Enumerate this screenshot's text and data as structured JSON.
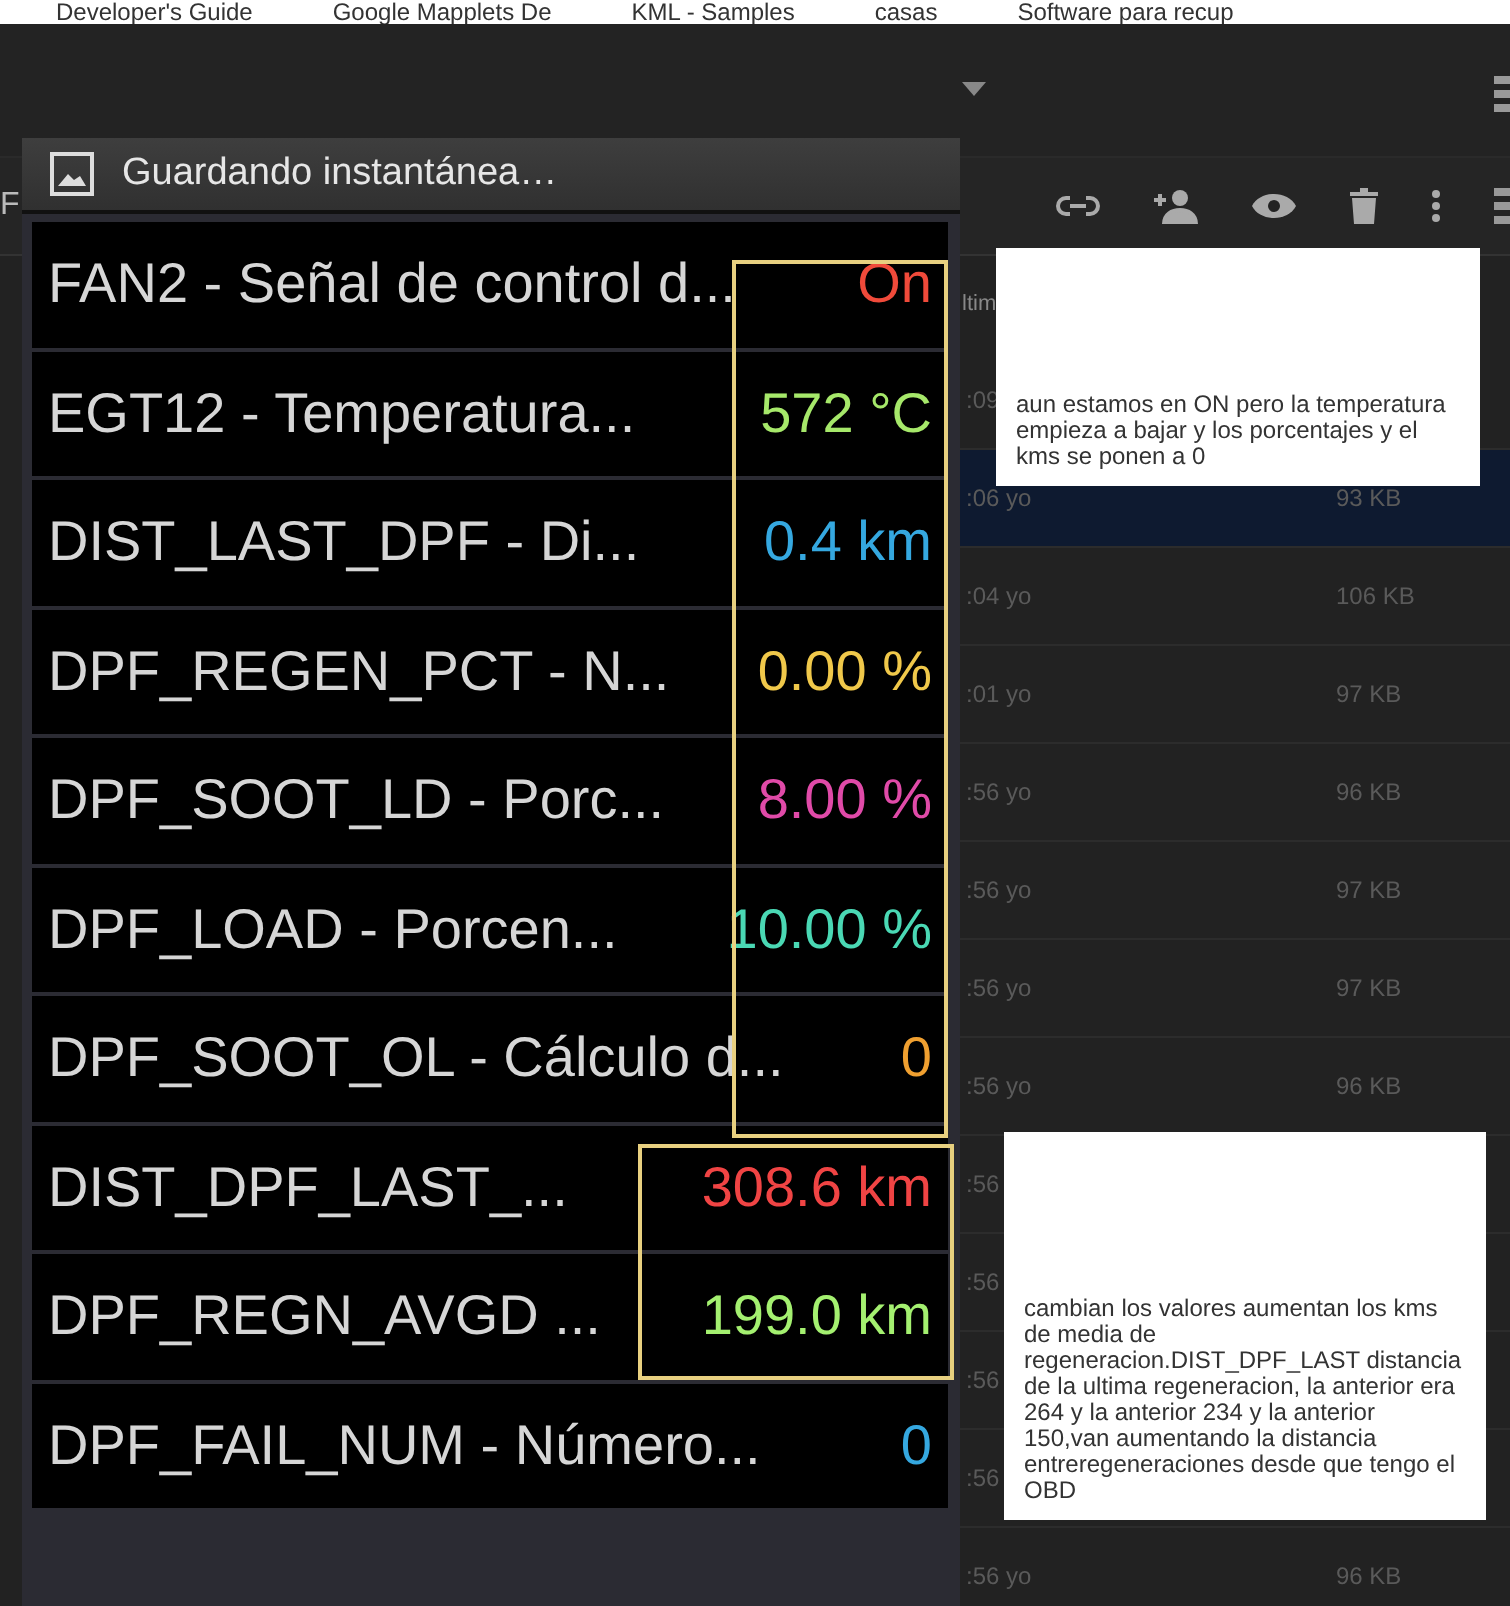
{
  "bookmarks": [
    "Developer's Guide",
    "Google Mapplets De",
    "KML - Samples",
    "casas",
    "Software para recup"
  ],
  "drive": {
    "column_heading": "ltim",
    "left_letter": "F",
    "rows": [
      {
        "time": ":09",
        "selected": false
      },
      {
        "time": ":06 yo",
        "size": "93 KB",
        "selected": true
      },
      {
        "time": ":04 yo",
        "size": "106 KB",
        "selected": false
      },
      {
        "time": ":01 yo",
        "size": "97 KB",
        "selected": false
      },
      {
        "time": ":56 yo",
        "size": "96 KB",
        "selected": false
      },
      {
        "time": ":56 yo",
        "size": "97 KB",
        "selected": false
      },
      {
        "time": ":56 yo",
        "size": "97 KB",
        "selected": false
      },
      {
        "time": ":56 yo",
        "size": "96 KB",
        "selected": false
      },
      {
        "time": ":56",
        "selected": false
      },
      {
        "time": ":56",
        "selected": false
      },
      {
        "time": ":56",
        "selected": false
      },
      {
        "time": ":56",
        "selected": false
      },
      {
        "time": ":56 yo",
        "size": "96 KB",
        "selected": false
      }
    ]
  },
  "snapshot": {
    "title": "Guardando instantánea…",
    "sensors": [
      {
        "name": "FAN2 - Señal de control d...",
        "value": "On",
        "color": "#f04a3a"
      },
      {
        "name": "EGT12 - Temperatura...",
        "value": "572 °C",
        "color": "#a6e86a"
      },
      {
        "name": "DIST_LAST_DPF - Di...",
        "value": "0.4 km",
        "color": "#35a8e0"
      },
      {
        "name": "DPF_REGEN_PCT - N...",
        "value": "0.00 %",
        "color": "#f0c84a"
      },
      {
        "name": "DPF_SOOT_LD - Porc...",
        "value": "8.00 %",
        "color": "#e04aa8"
      },
      {
        "name": "DPF_LOAD - Porcen...",
        "value": "10.00 %",
        "color": "#4ad8b4"
      },
      {
        "name": "DPF_SOOT_OL - Cálculo d...",
        "value": "0",
        "color": "#f0a030"
      },
      {
        "name": "DIST_DPF_LAST_...",
        "value": "308.6 km",
        "color": "#f04444"
      },
      {
        "name": "DPF_REGN_AVGD ...",
        "value": "199.0 km",
        "color": "#a4f070"
      },
      {
        "name": "DPF_FAIL_NUM - Número...",
        "value": "0",
        "color": "#35a8e0"
      }
    ]
  },
  "notes": [
    "aun estamos en ON pero la temperatura empieza a bajar y los porcentajes y el kms se ponen a 0",
    "cambian los valores aumentan los kms de media de regeneracion.DIST_DPF_LAST distancia de la ultima regeneracion, la anterior era 264 y la anterior 234 y la anterior 150,van aumentando la distancia entreregeneraciones desde que tengo el OBD"
  ]
}
